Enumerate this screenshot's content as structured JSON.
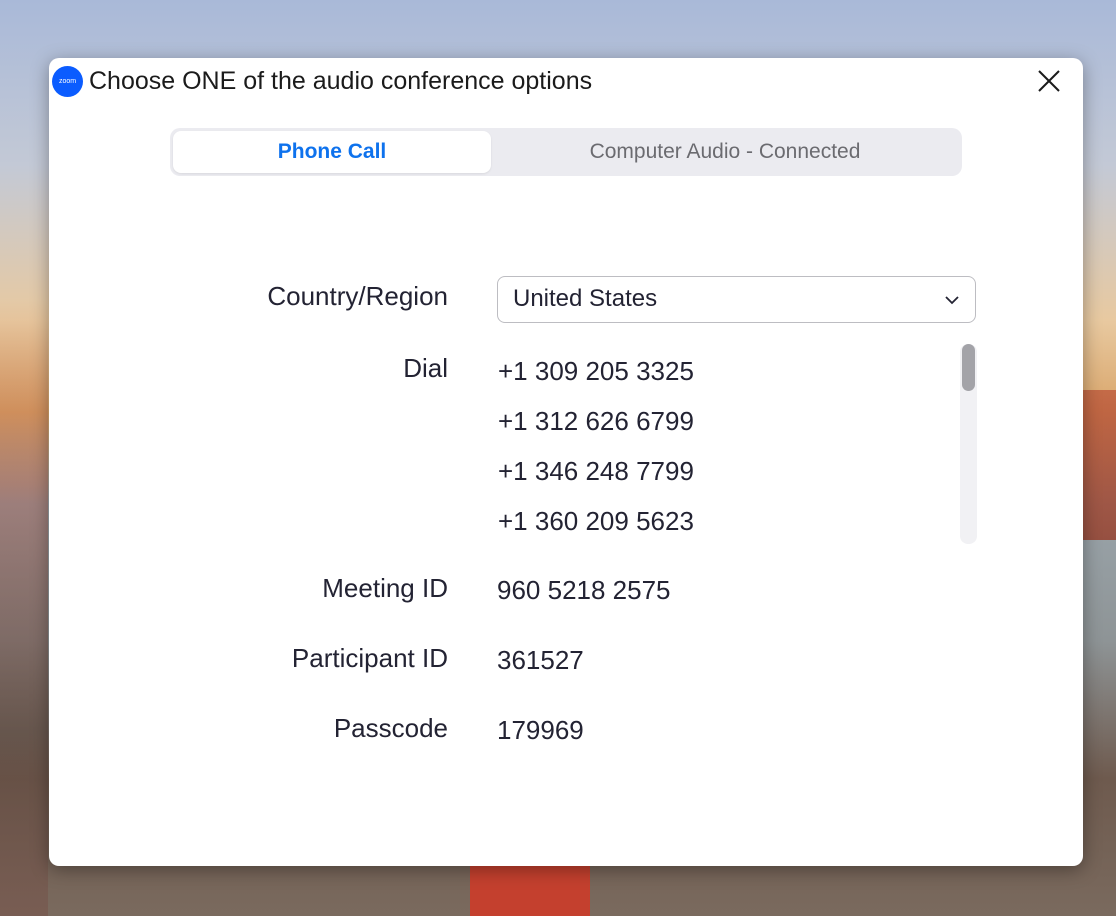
{
  "window": {
    "title": "Choose ONE of the audio conference options",
    "app_icon_text": "zoom"
  },
  "tabs": [
    {
      "label": "Phone Call",
      "active": true
    },
    {
      "label": "Computer Audio - Connected",
      "active": false
    }
  ],
  "form": {
    "country_label": "Country/Region",
    "country_value": "United States",
    "dial_label": "Dial",
    "dial_numbers": [
      "+1 309 205 3325",
      "+1 312 626 6799",
      "+1 346 248 7799",
      "+1 360 209 5623"
    ],
    "meeting_id_label": "Meeting ID",
    "meeting_id_value": "960 5218 2575",
    "participant_id_label": "Participant ID",
    "participant_id_value": "361527",
    "passcode_label": "Passcode",
    "passcode_value": "179969"
  },
  "colors": {
    "accent": "#0e72ed",
    "app_icon": "#0b5cff"
  },
  "icons": {
    "close": "close-icon",
    "chevron": "chevron-down-icon"
  }
}
